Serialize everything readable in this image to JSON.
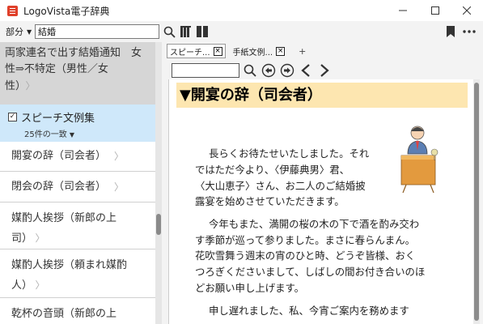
{
  "window": {
    "title": "LogoVista電子辞典"
  },
  "toolbar": {
    "mode_label": "部分",
    "search_value": "結婚"
  },
  "left": {
    "top_hit_text": "両家連名で出す結婚通知　女性⇒不特定（男性／女性）",
    "top_hit_line1": "両家連名で出す結婚通知　女",
    "top_hit_line2": "性⇒不特定（男性／女",
    "top_hit_line3": "性）",
    "group": {
      "name": "スピーチ文例集",
      "count": "25件の一致"
    },
    "items": [
      {
        "label": "開宴の辞（司会者）"
      },
      {
        "label": "閉会の辞（司会者）"
      },
      {
        "label_line1": "媒酌人挨拶（新郎の上",
        "label_line2": "司）"
      },
      {
        "label_line1": "媒酌人挨拶（頼まれ媒酌",
        "label_line2": "人）"
      },
      {
        "label_line1": "乾杯の音頭（新郎の上"
      }
    ]
  },
  "tabs": [
    {
      "label": "スピーチ...",
      "close": "×"
    },
    {
      "label": "手紙文例...",
      "close": "×"
    }
  ],
  "tab_add": "+",
  "document": {
    "heading": "▼開宴の辞（司会者）",
    "paragraph1": [
      "長らくお待たせいたしました。それ",
      "ではただ今より、〈伊藤典男〉君、",
      "〈大山恵子〉さん、お二人のご結婚披",
      "露宴を始めさせていただきます。"
    ],
    "paragraph2": [
      "今年もまた、満開の桜の木の下で酒を酌み交わ",
      "す季節が巡って参りました。まさに春らんまん。",
      "花吹雪舞う週末の宵のひと時、どうぞ皆様、おく",
      "つろぎくださいまして、しばしの間お付き合いのほ",
      "どお願い申し上げます。"
    ],
    "paragraph3": [
      "申し遅れました、私、今宵ご案内を務めます"
    ]
  },
  "colors": {
    "heading_bg": "#fde6b0",
    "selected_group_bg": "#cfe8fa",
    "app_icon": "#e0402a"
  },
  "icons": [
    "app-icon",
    "dropdown-caret",
    "search-icon",
    "books-icon",
    "columns-icon",
    "bookmark-icon",
    "more-icon",
    "back-icon",
    "forward-icon",
    "prev-arrow-icon",
    "next-arrow-icon",
    "chevron-right-icon"
  ]
}
